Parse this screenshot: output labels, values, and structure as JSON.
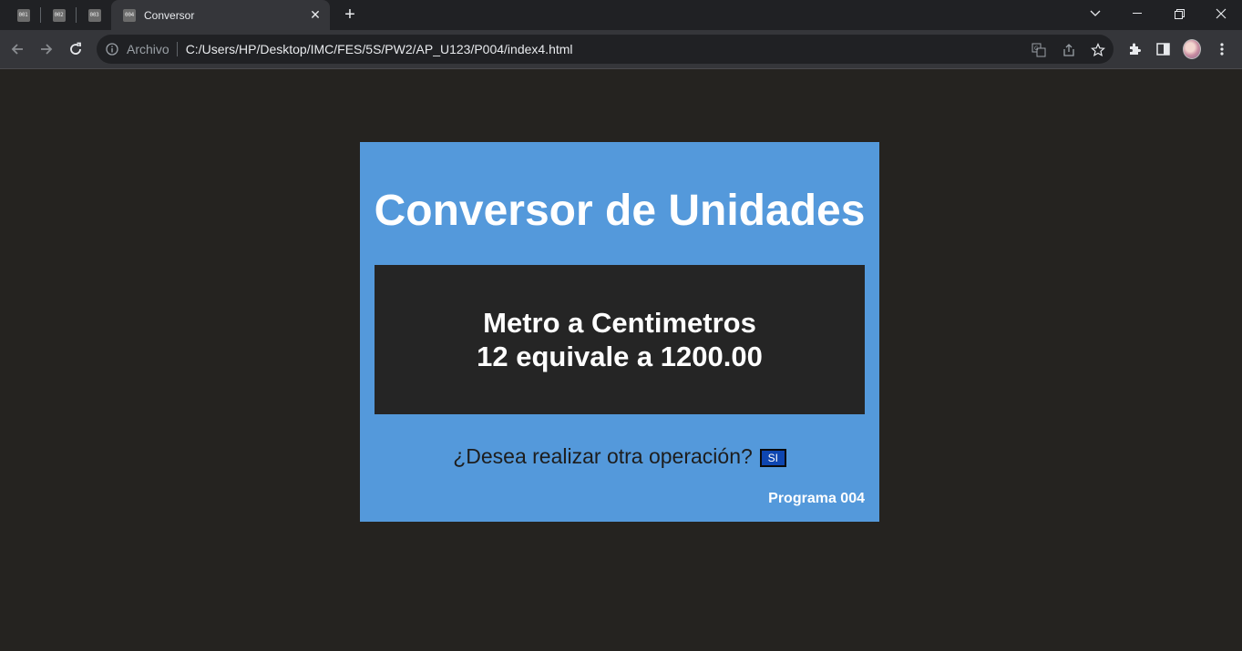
{
  "browser": {
    "tabs": [
      {
        "favicon": "001"
      },
      {
        "favicon": "002"
      },
      {
        "favicon": "003"
      },
      {
        "favicon": "004",
        "title": "Conversor",
        "active": true
      }
    ],
    "omnibox": {
      "security_label": "Archivo",
      "url": "C:/Users/HP/Desktop/IMC/FES/5S/PW2/AP_U123/P004/index4.html"
    },
    "icons": [
      "back-icon",
      "forward-icon",
      "reload-icon",
      "info-icon",
      "translate-icon",
      "share-icon",
      "star-icon",
      "extensions-icon",
      "side-panel-icon",
      "avatar",
      "more-icon"
    ]
  },
  "page": {
    "title": "Conversor de Unidades",
    "result": {
      "conversion": "Metro a Centimetros",
      "statement": "12 equivale a 1200.00"
    },
    "question": "¿Desea realizar otra operación?",
    "yes_button": "SI",
    "footer": "Programa 004"
  },
  "colors": {
    "page_background": "#252320",
    "card_background": "#5499db",
    "result_background": "#252525",
    "button_background": "#0e46b1"
  }
}
